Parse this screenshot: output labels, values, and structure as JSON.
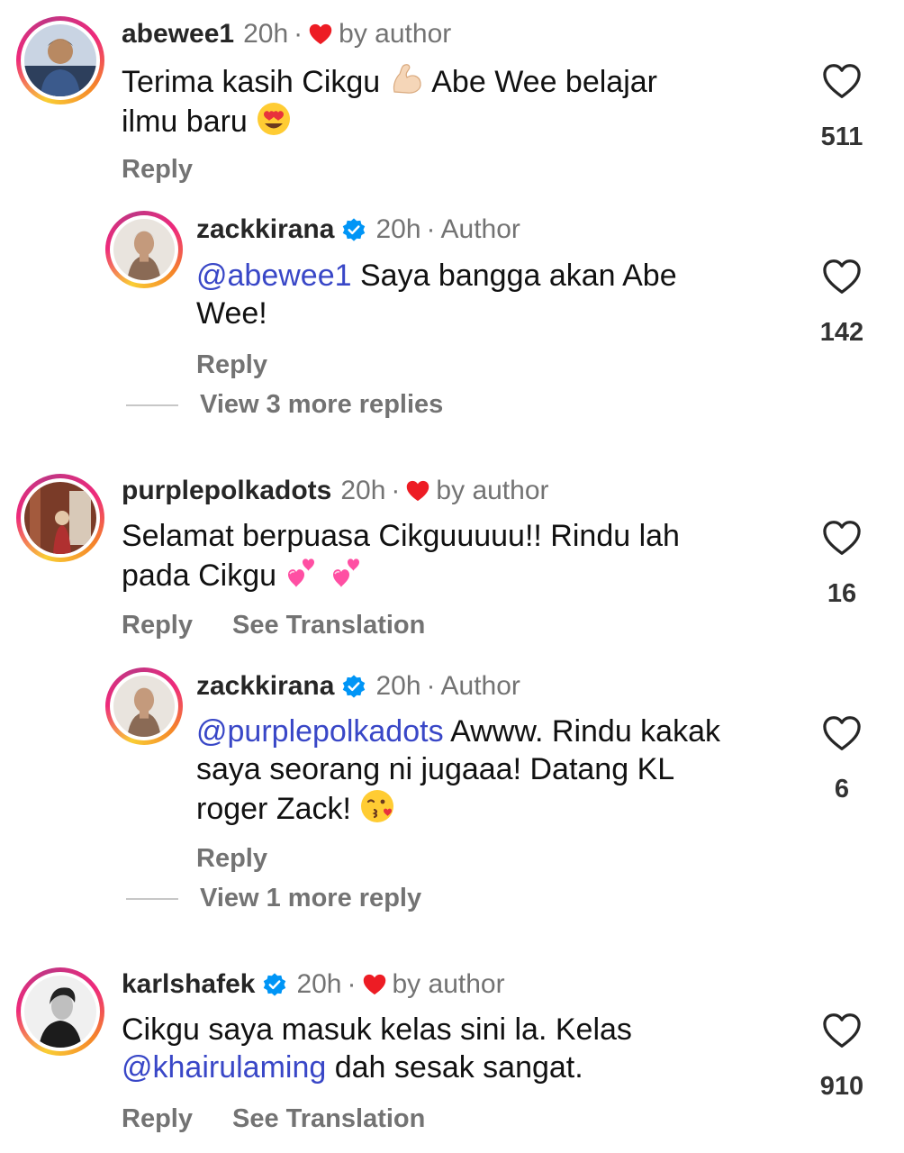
{
  "comments": [
    {
      "username": "abewee1",
      "time": "20h",
      "badge": "by author",
      "text_parts": [
        "Terima kasih Cikgu",
        "Abe Wee belajar",
        "ilmu baru"
      ],
      "emojis": [
        "flexed-biceps",
        "heart-eyes"
      ],
      "likes": "511",
      "reply_label": "Reply"
    },
    {
      "username": "zackkirana",
      "time": "20h",
      "badge": "Author",
      "mention": "@abewee1",
      "text": "Saya bangga akan Abe",
      "text2": "Wee!",
      "likes": "142",
      "reply_label": "Reply",
      "view_more": "View 3 more replies"
    },
    {
      "username": "purplepolkadots",
      "time": "20h",
      "badge": "by author",
      "text": "Selamat berpuasa Cikguuuuu!! Rindu lah",
      "text2": "pada Cikgu",
      "emojis": [
        "two-hearts",
        "two-hearts"
      ],
      "likes": "16",
      "reply_label": "Reply",
      "translate_label": "See Translation"
    },
    {
      "username": "zackkirana",
      "time": "20h",
      "badge": "Author",
      "mention": "@purplepolkadots",
      "text": "Awww. Rindu kakak",
      "text2": "saya seorang ni jugaaa! Datang KL",
      "text3": "roger Zack!",
      "emojis": [
        "face-blowing-kiss"
      ],
      "likes": "6",
      "reply_label": "Reply",
      "view_more": "View 1 more reply"
    },
    {
      "username": "karlshafek",
      "time": "20h",
      "badge": "by author",
      "text": "Cikgu saya masuk kelas sini la. Kelas",
      "mention": "@khairulaming",
      "text2": "dah sesak sangat.",
      "likes": "910",
      "reply_label": "Reply",
      "translate_label": "See Translation"
    }
  ],
  "icons": {
    "like": "heart-outline-icon",
    "author_like": "heart-filled-icon",
    "verified": "verified-badge-icon"
  },
  "colors": {
    "mention": "#3947c7",
    "author_heart": "#ed1c24",
    "verified": "#0095f6",
    "muted": "#737373"
  }
}
